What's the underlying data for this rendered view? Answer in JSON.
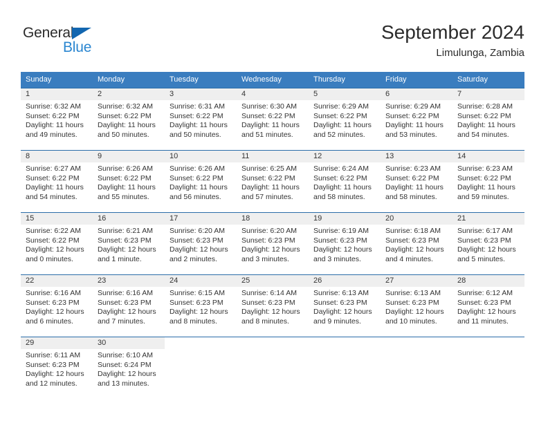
{
  "brand": {
    "name_part1": "General",
    "name_part2": "Blue",
    "triangle_icon": "triangle-icon",
    "accent_color": "#2a86d0",
    "header_color": "#3a7dbf"
  },
  "header": {
    "month_title": "September 2024",
    "location": "Limulunga, Zambia"
  },
  "weekdays": [
    {
      "label": "Sunday"
    },
    {
      "label": "Monday"
    },
    {
      "label": "Tuesday"
    },
    {
      "label": "Wednesday"
    },
    {
      "label": "Thursday"
    },
    {
      "label": "Friday"
    },
    {
      "label": "Saturday"
    }
  ],
  "weeks": [
    [
      {
        "day": "1",
        "sunrise": "Sunrise: 6:32 AM",
        "sunset": "Sunset: 6:22 PM",
        "daylight": "Daylight: 11 hours and 49 minutes."
      },
      {
        "day": "2",
        "sunrise": "Sunrise: 6:32 AM",
        "sunset": "Sunset: 6:22 PM",
        "daylight": "Daylight: 11 hours and 50 minutes."
      },
      {
        "day": "3",
        "sunrise": "Sunrise: 6:31 AM",
        "sunset": "Sunset: 6:22 PM",
        "daylight": "Daylight: 11 hours and 50 minutes."
      },
      {
        "day": "4",
        "sunrise": "Sunrise: 6:30 AM",
        "sunset": "Sunset: 6:22 PM",
        "daylight": "Daylight: 11 hours and 51 minutes."
      },
      {
        "day": "5",
        "sunrise": "Sunrise: 6:29 AM",
        "sunset": "Sunset: 6:22 PM",
        "daylight": "Daylight: 11 hours and 52 minutes."
      },
      {
        "day": "6",
        "sunrise": "Sunrise: 6:29 AM",
        "sunset": "Sunset: 6:22 PM",
        "daylight": "Daylight: 11 hours and 53 minutes."
      },
      {
        "day": "7",
        "sunrise": "Sunrise: 6:28 AM",
        "sunset": "Sunset: 6:22 PM",
        "daylight": "Daylight: 11 hours and 54 minutes."
      }
    ],
    [
      {
        "day": "8",
        "sunrise": "Sunrise: 6:27 AM",
        "sunset": "Sunset: 6:22 PM",
        "daylight": "Daylight: 11 hours and 54 minutes."
      },
      {
        "day": "9",
        "sunrise": "Sunrise: 6:26 AM",
        "sunset": "Sunset: 6:22 PM",
        "daylight": "Daylight: 11 hours and 55 minutes."
      },
      {
        "day": "10",
        "sunrise": "Sunrise: 6:26 AM",
        "sunset": "Sunset: 6:22 PM",
        "daylight": "Daylight: 11 hours and 56 minutes."
      },
      {
        "day": "11",
        "sunrise": "Sunrise: 6:25 AM",
        "sunset": "Sunset: 6:22 PM",
        "daylight": "Daylight: 11 hours and 57 minutes."
      },
      {
        "day": "12",
        "sunrise": "Sunrise: 6:24 AM",
        "sunset": "Sunset: 6:22 PM",
        "daylight": "Daylight: 11 hours and 58 minutes."
      },
      {
        "day": "13",
        "sunrise": "Sunrise: 6:23 AM",
        "sunset": "Sunset: 6:22 PM",
        "daylight": "Daylight: 11 hours and 58 minutes."
      },
      {
        "day": "14",
        "sunrise": "Sunrise: 6:23 AM",
        "sunset": "Sunset: 6:22 PM",
        "daylight": "Daylight: 11 hours and 59 minutes."
      }
    ],
    [
      {
        "day": "15",
        "sunrise": "Sunrise: 6:22 AM",
        "sunset": "Sunset: 6:22 PM",
        "daylight": "Daylight: 12 hours and 0 minutes."
      },
      {
        "day": "16",
        "sunrise": "Sunrise: 6:21 AM",
        "sunset": "Sunset: 6:23 PM",
        "daylight": "Daylight: 12 hours and 1 minute."
      },
      {
        "day": "17",
        "sunrise": "Sunrise: 6:20 AM",
        "sunset": "Sunset: 6:23 PM",
        "daylight": "Daylight: 12 hours and 2 minutes."
      },
      {
        "day": "18",
        "sunrise": "Sunrise: 6:20 AM",
        "sunset": "Sunset: 6:23 PM",
        "daylight": "Daylight: 12 hours and 3 minutes."
      },
      {
        "day": "19",
        "sunrise": "Sunrise: 6:19 AM",
        "sunset": "Sunset: 6:23 PM",
        "daylight": "Daylight: 12 hours and 3 minutes."
      },
      {
        "day": "20",
        "sunrise": "Sunrise: 6:18 AM",
        "sunset": "Sunset: 6:23 PM",
        "daylight": "Daylight: 12 hours and 4 minutes."
      },
      {
        "day": "21",
        "sunrise": "Sunrise: 6:17 AM",
        "sunset": "Sunset: 6:23 PM",
        "daylight": "Daylight: 12 hours and 5 minutes."
      }
    ],
    [
      {
        "day": "22",
        "sunrise": "Sunrise: 6:16 AM",
        "sunset": "Sunset: 6:23 PM",
        "daylight": "Daylight: 12 hours and 6 minutes."
      },
      {
        "day": "23",
        "sunrise": "Sunrise: 6:16 AM",
        "sunset": "Sunset: 6:23 PM",
        "daylight": "Daylight: 12 hours and 7 minutes."
      },
      {
        "day": "24",
        "sunrise": "Sunrise: 6:15 AM",
        "sunset": "Sunset: 6:23 PM",
        "daylight": "Daylight: 12 hours and 8 minutes."
      },
      {
        "day": "25",
        "sunrise": "Sunrise: 6:14 AM",
        "sunset": "Sunset: 6:23 PM",
        "daylight": "Daylight: 12 hours and 8 minutes."
      },
      {
        "day": "26",
        "sunrise": "Sunrise: 6:13 AM",
        "sunset": "Sunset: 6:23 PM",
        "daylight": "Daylight: 12 hours and 9 minutes."
      },
      {
        "day": "27",
        "sunrise": "Sunrise: 6:13 AM",
        "sunset": "Sunset: 6:23 PM",
        "daylight": "Daylight: 12 hours and 10 minutes."
      },
      {
        "day": "28",
        "sunrise": "Sunrise: 6:12 AM",
        "sunset": "Sunset: 6:23 PM",
        "daylight": "Daylight: 12 hours and 11 minutes."
      }
    ],
    [
      {
        "day": "29",
        "sunrise": "Sunrise: 6:11 AM",
        "sunset": "Sunset: 6:23 PM",
        "daylight": "Daylight: 12 hours and 12 minutes."
      },
      {
        "day": "30",
        "sunrise": "Sunrise: 6:10 AM",
        "sunset": "Sunset: 6:24 PM",
        "daylight": "Daylight: 12 hours and 13 minutes."
      },
      {
        "day": "",
        "sunrise": "",
        "sunset": "",
        "daylight": ""
      },
      {
        "day": "",
        "sunrise": "",
        "sunset": "",
        "daylight": ""
      },
      {
        "day": "",
        "sunrise": "",
        "sunset": "",
        "daylight": ""
      },
      {
        "day": "",
        "sunrise": "",
        "sunset": "",
        "daylight": ""
      },
      {
        "day": "",
        "sunrise": "",
        "sunset": "",
        "daylight": ""
      }
    ]
  ]
}
